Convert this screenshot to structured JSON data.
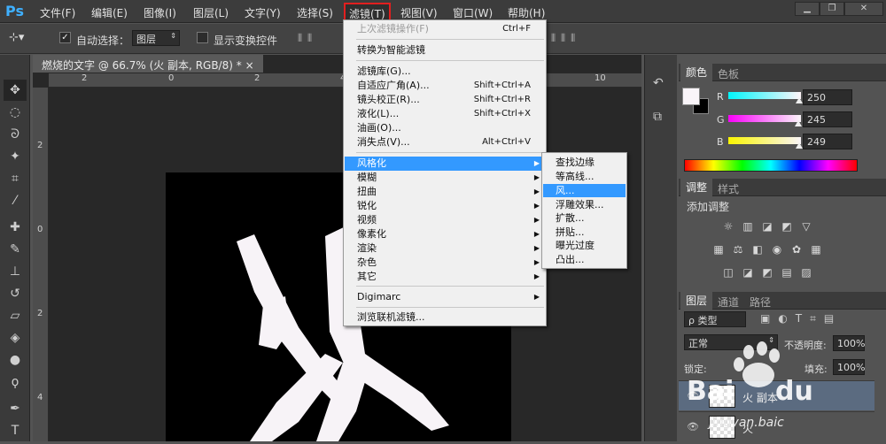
{
  "app": {
    "logo": "Ps"
  },
  "menubar": {
    "items": [
      "文件(F)",
      "编辑(E)",
      "图像(I)",
      "图层(L)",
      "文字(Y)",
      "选择(S)",
      "滤镜(T)",
      "视图(V)",
      "窗口(W)",
      "帮助(H)"
    ],
    "active_item": "滤镜(T)",
    "window_controls": [
      "▁",
      "❐",
      "✕"
    ]
  },
  "options_bar": {
    "auto_select_label": "自动选择：",
    "auto_select_checked": true,
    "auto_select_value": "图层",
    "show_transform_label": "显示变换控件",
    "show_transform_checked": false
  },
  "document": {
    "tab_title": "燃烧的文字 @ 66.7% (火 副本, RGB/8) *",
    "tab_close": "×",
    "ruler_h": [
      "2",
      "0",
      "2",
      "4",
      "6",
      "8",
      "10",
      "12"
    ],
    "ruler_v": [
      "2",
      "0",
      "2",
      "4",
      "6",
      "8"
    ]
  },
  "filter_menu": {
    "items": [
      {
        "label": "上次滤镜操作(F)",
        "shortcut": "Ctrl+F",
        "disabled": true
      },
      {
        "sep": true
      },
      {
        "label": "转换为智能滤镜"
      },
      {
        "sep": true
      },
      {
        "label": "滤镜库(G)...",
        "shortcut": ""
      },
      {
        "label": "自适应广角(A)...",
        "shortcut": "Shift+Ctrl+A"
      },
      {
        "label": "镜头校正(R)...",
        "shortcut": "Shift+Ctrl+R"
      },
      {
        "label": "液化(L)...",
        "shortcut": "Shift+Ctrl+X"
      },
      {
        "label": "油画(O)...",
        "shortcut": ""
      },
      {
        "label": "消失点(V)...",
        "shortcut": "Alt+Ctrl+V"
      },
      {
        "sep": true
      },
      {
        "label": "风格化",
        "submenu": true,
        "highlighted": true
      },
      {
        "label": "模糊",
        "submenu": true
      },
      {
        "label": "扭曲",
        "submenu": true
      },
      {
        "label": "锐化",
        "submenu": true
      },
      {
        "label": "视频",
        "submenu": true
      },
      {
        "label": "像素化",
        "submenu": true
      },
      {
        "label": "渲染",
        "submenu": true
      },
      {
        "label": "杂色",
        "submenu": true
      },
      {
        "label": "其它",
        "submenu": true
      },
      {
        "sep": true
      },
      {
        "label": "Digimarc",
        "submenu": true
      },
      {
        "sep": true
      },
      {
        "label": "浏览联机滤镜..."
      }
    ]
  },
  "stylize_submenu": {
    "items": [
      "查找边缘",
      "等高线...",
      "风...",
      "浮雕效果...",
      "扩散...",
      "拼贴...",
      "曝光过度",
      "凸出..."
    ],
    "highlighted": "风..."
  },
  "color_panel": {
    "tabs": [
      "颜色",
      "色板"
    ],
    "channels": [
      {
        "name": "R",
        "value": "250",
        "fraction": 0.98,
        "gradient": "linear-gradient(90deg,#00f5f9,#fff5f9)"
      },
      {
        "name": "G",
        "value": "245",
        "fraction": 0.96,
        "gradient": "linear-gradient(90deg,#fa00f9,#faf5f9)"
      },
      {
        "name": "B",
        "value": "249",
        "fraction": 0.98,
        "gradient": "linear-gradient(90deg,#faf500,#faf5f9)"
      }
    ],
    "foreground": "#faf5f9",
    "background": "#000000"
  },
  "adjust_panel": {
    "tabs": [
      "调整",
      "样式"
    ],
    "title": "添加调整"
  },
  "layers_panel": {
    "tabs": [
      "图层",
      "通道",
      "路径"
    ],
    "filter_label": "ρ 类型",
    "blend_mode": "正常",
    "opacity_label": "不透明度:",
    "opacity_value": "100%",
    "lock_label": "锁定:",
    "fill_label": "填充:",
    "fill_value": "100%",
    "layers": [
      {
        "name": "火 副本",
        "selected": true
      },
      {
        "name": "火",
        "selected": false
      }
    ]
  },
  "watermark": {
    "text": "jingyan.baic"
  }
}
